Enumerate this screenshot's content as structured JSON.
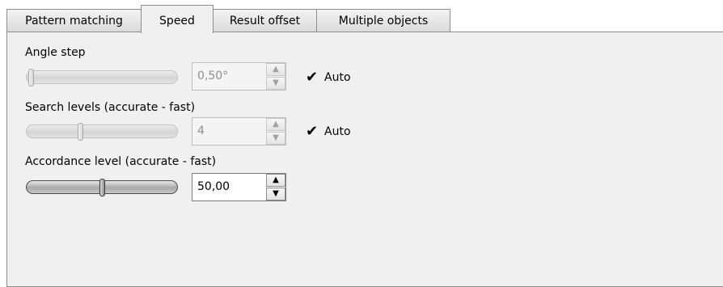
{
  "tabs": [
    {
      "label": "Pattern matching",
      "active": false
    },
    {
      "label": "Speed",
      "active": true
    },
    {
      "label": "Result offset",
      "active": false
    },
    {
      "label": "Multiple objects",
      "active": false
    }
  ],
  "angle_step": {
    "label": "Angle step",
    "value": "0,50°",
    "slider_position": 0.0,
    "enabled": false,
    "auto_label": "Auto",
    "auto_checked": true
  },
  "search_levels": {
    "label": "Search levels (accurate - fast)",
    "value": "4",
    "slider_position": 0.35,
    "enabled": false,
    "auto_label": "Auto",
    "auto_checked": true
  },
  "accordance_level": {
    "label": "Accordance level (accurate - fast)",
    "value": "50,00",
    "slider_position": 0.5,
    "enabled": true
  },
  "icons": {
    "check_glyph": "✔",
    "up_glyph": "▲",
    "down_glyph": "▼"
  }
}
